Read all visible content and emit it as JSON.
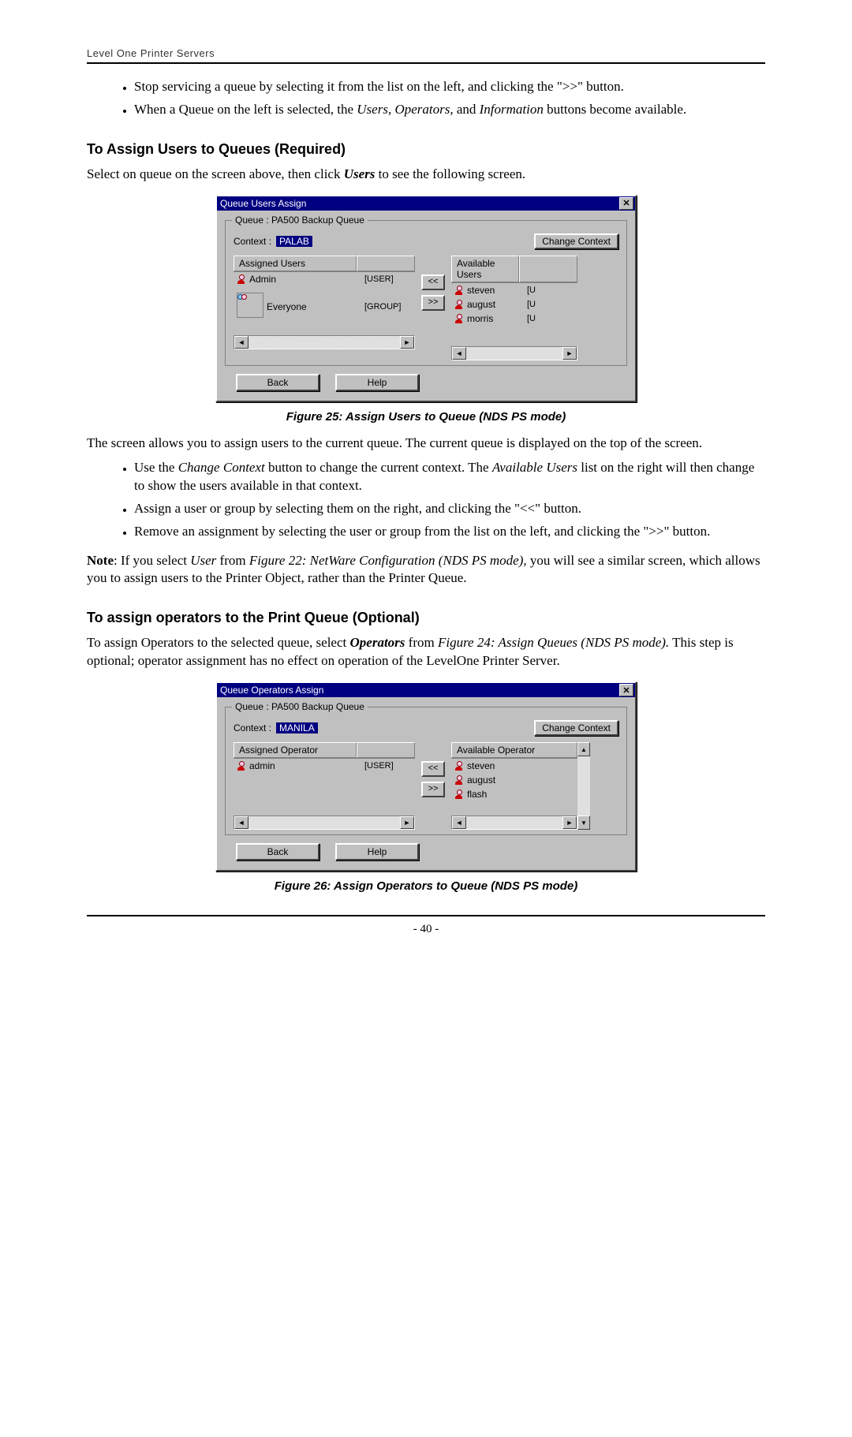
{
  "header": "Level One Printer Servers",
  "page_number": "- 40 -",
  "bullets_top": [
    "Stop servicing a queue by selecting it from the list on the left, and clicking the \">>\" button.",
    "When a Queue on the left is selected, the Users, Operators, and Information buttons become available."
  ],
  "section1": {
    "title": "To Assign Users to Queues (Required)",
    "intro_pre": "Select on queue on the screen above, then click ",
    "intro_bold": "Users",
    "intro_post": " to see the following screen.",
    "caption": "Figure 25: Assign Users to Queue (NDS PS mode)",
    "after": "The screen allows you to assign users to the current queue. The current queue is displayed on the top of the screen.",
    "bullets": [
      "Use the Change Context button to change the current context. The Available Users list on the right will then change to show the users available in that context.",
      "Assign a user or group by selecting them on the right, and clicking the \"<<\" button.",
      "Remove an assignment by selecting the user or group from the list on the left, and clicking the \">>\" button."
    ]
  },
  "note": {
    "label": "Note",
    "pre": ": If you select ",
    "it1": "User",
    "mid": " from ",
    "it2": "Figure 22: NetWare Configuration (NDS PS mode),",
    "post": " you will see a similar screen, which allows you to assign users to the Printer Object, rather than the Printer Queue."
  },
  "section2": {
    "title": "To assign operators to the Print Queue (Optional)",
    "p_pre": "To assign Operators to the selected queue, select ",
    "p_bold": "Operators",
    "p_mid": " from ",
    "p_it": "Figure 24: Assign Queues (NDS PS mode).",
    "p_post": " This step is optional; operator assignment has no effect on operation of the LevelOne Printer Server.",
    "caption": "Figure 26: Assign Operators to Queue (NDS PS mode)"
  },
  "dlg1": {
    "title": "Queue Users Assign",
    "queue": "Queue : PA500 Backup Queue",
    "ctx_label": "Context :",
    "ctx_value": "PALAB",
    "change": "Change Context",
    "left_head": "Assigned Users",
    "right_head": "Available Users",
    "left": [
      {
        "n": "Admin",
        "t": "[USER]",
        "k": "user"
      },
      {
        "n": "Everyone",
        "t": "[GROUP]",
        "k": "grp"
      }
    ],
    "right": [
      {
        "n": "steven",
        "t": "[U",
        "k": "user"
      },
      {
        "n": "august",
        "t": "[U",
        "k": "user"
      },
      {
        "n": "morris",
        "t": "[U",
        "k": "user"
      }
    ],
    "back": "Back",
    "help": "Help",
    "ll": "<<",
    "rr": ">>"
  },
  "dlg2": {
    "title": "Queue Operators Assign",
    "queue": "Queue : PA500 Backup Queue",
    "ctx_label": "Context :",
    "ctx_value": "MANILA",
    "change": "Change Context",
    "left_head": "Assigned Operator",
    "right_head": "Available Operator",
    "left": [
      {
        "n": "admin",
        "t": "[USER]",
        "k": "user"
      }
    ],
    "right": [
      {
        "n": "steven",
        "t": "",
        "k": "user"
      },
      {
        "n": "august",
        "t": "",
        "k": "user"
      },
      {
        "n": "flash",
        "t": "",
        "k": "user"
      }
    ],
    "back": "Back",
    "help": "Help",
    "ll": "<<",
    "rr": ">>"
  }
}
